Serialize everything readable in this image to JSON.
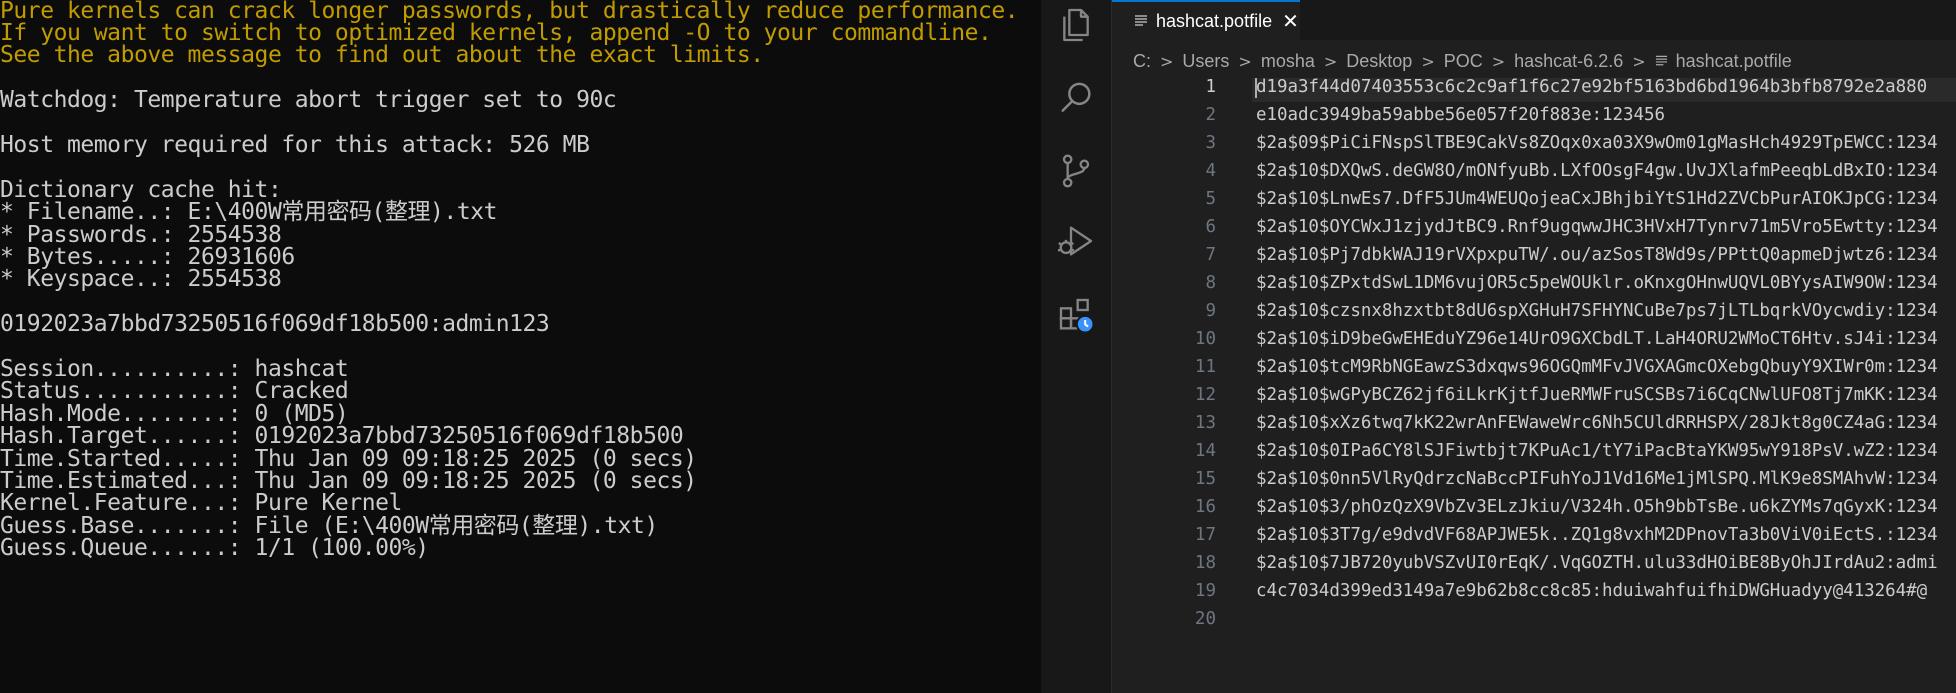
{
  "terminal": {
    "lines": [
      {
        "text": "Pure kernels can crack longer passwords, but drastically reduce performance.",
        "tone": "warn"
      },
      {
        "text": "If you want to switch to optimized kernels, append -O to your commandline.",
        "tone": "warn"
      },
      {
        "text": "See the above message to find out about the exact limits.",
        "tone": "warn"
      },
      {
        "text": "",
        "tone": "normal"
      },
      {
        "text": "Watchdog: Temperature abort trigger set to 90c",
        "tone": "normal"
      },
      {
        "text": "",
        "tone": "normal"
      },
      {
        "text": "Host memory required for this attack: 526 MB",
        "tone": "normal"
      },
      {
        "text": "",
        "tone": "normal"
      },
      {
        "text": "Dictionary cache hit:",
        "tone": "normal"
      },
      {
        "text": "* Filename..: E:\\400W常用密码(整理).txt",
        "tone": "normal"
      },
      {
        "text": "* Passwords.: 2554538",
        "tone": "normal"
      },
      {
        "text": "* Bytes.....: 26931606",
        "tone": "normal"
      },
      {
        "text": "* Keyspace..: 2554538",
        "tone": "normal"
      },
      {
        "text": "",
        "tone": "normal"
      },
      {
        "text": "0192023a7bbd73250516f069df18b500:admin123",
        "tone": "normal"
      },
      {
        "text": "",
        "tone": "normal"
      },
      {
        "text": "Session..........: hashcat",
        "tone": "normal"
      },
      {
        "text": "Status...........: Cracked",
        "tone": "normal"
      },
      {
        "text": "Hash.Mode........: 0 (MD5)",
        "tone": "normal"
      },
      {
        "text": "Hash.Target......: 0192023a7bbd73250516f069df18b500",
        "tone": "normal"
      },
      {
        "text": "Time.Started.....: Thu Jan 09 09:18:25 2025 (0 secs)",
        "tone": "normal"
      },
      {
        "text": "Time.Estimated...: Thu Jan 09 09:18:25 2025 (0 secs)",
        "tone": "normal"
      },
      {
        "text": "Kernel.Feature...: Pure Kernel",
        "tone": "normal"
      },
      {
        "text": "Guess.Base.......: File (E:\\400W常用密码(整理).txt)",
        "tone": "normal"
      },
      {
        "text": "Guess.Queue......: 1/1 (100.00%)",
        "tone": "normal"
      }
    ]
  },
  "vscode": {
    "activity_bar": [
      {
        "icon": "files-icon"
      },
      {
        "icon": "search-icon"
      },
      {
        "icon": "source-control-icon"
      },
      {
        "icon": "run-debug-icon"
      },
      {
        "icon": "extensions-icon"
      }
    ],
    "tab": {
      "label": "hashcat.potfile",
      "close_glyph": "✕"
    },
    "breadcrumb": {
      "separator": ">",
      "items": [
        "C:",
        "Users",
        "mosha",
        "Desktop",
        "POC",
        "hashcat-6.2.6",
        "hashcat.potfile"
      ]
    },
    "editor": {
      "active_line": 1,
      "lines": [
        {
          "no": "1",
          "text": "d19a3f44d07403553c6c2c9af1f6c27e92bf5163bd6bd1964b3bfb8792e2a880"
        },
        {
          "no": "2",
          "text": "e10adc3949ba59abbe56e057f20f883e:123456"
        },
        {
          "no": "3",
          "text": "$2a$09$PiCiFNspSlTBE9CakVs8ZOqx0xa03X9wOm01gMasHch4929TpEWCC:1234"
        },
        {
          "no": "4",
          "text": "$2a$10$DXQwS.deGW8O/mONfyuBb.LXfOOsgF4gw.UvJXlafmPeeqbLdBxIO:1234"
        },
        {
          "no": "5",
          "text": "$2a$10$LnwEs7.DfF5JUm4WEUQojeaCxJBhjbiYtS1Hd2ZVCbPurAIOKJpCG:1234"
        },
        {
          "no": "6",
          "text": "$2a$10$OYCWxJ1zjydJtBC9.Rnf9ugqwwJHC3HVxH7Tynrv71m5Vro5Ewtty:1234"
        },
        {
          "no": "7",
          "text": "$2a$10$Pj7dbkWAJ19rVXpxpuTW/.ou/azSosT8Wd9s/PPttQ0apmeDjwtz6:1234"
        },
        {
          "no": "8",
          "text": "$2a$10$ZPxtdSwL1DM6vujOR5c5peWOUklr.oKnxgOHnwUQVL0BYysAIW9OW:1234"
        },
        {
          "no": "9",
          "text": "$2a$10$czsnx8hzxtbt8dU6spXGHuH7SFHYNCuBe7ps7jLTLbqrkVOycwdiy:1234"
        },
        {
          "no": "10",
          "text": "$2a$10$iD9beGwEHEduYZ96e14UrO9GXCbdLT.LaH4ORU2WMoCT6Htv.sJ4i:1234"
        },
        {
          "no": "11",
          "text": "$2a$10$tcM9RbNGEawzS3dxqws96OGQmMFvJVGXAGmcOXebgQbuyY9XIWr0m:1234"
        },
        {
          "no": "12",
          "text": "$2a$10$wGPyBCZ62jf6iLkrKjtfJueRMWFruSCSBs7i6CqCNwlUFO8Tj7mKK:1234"
        },
        {
          "no": "13",
          "text": "$2a$10$xXz6twq7kK22wrAnFEWaweWrc6Nh5CUldRRHSPX/28Jkt8g0CZ4aG:1234"
        },
        {
          "no": "14",
          "text": "$2a$10$0IPa6CY8lSJFiwtbjt7KPuAc1/tY7iPacBtaYKW95wY918PsV.wZ2:1234"
        },
        {
          "no": "15",
          "text": "$2a$10$0nn5VlRyQdrzcNaBccPIFuhYoJ1Vd16Me1jMlSPQ.MlK9e8SMAhvW:1234"
        },
        {
          "no": "16",
          "text": "$2a$10$3/phOzQzX9VbZv3ELzJkiu/V324h.O5h9bbTsBe.u6kZYMs7qGyxK:1234"
        },
        {
          "no": "17",
          "text": "$2a$10$3T7g/e9dvdVF68APJWE5k..ZQ1g8vxhM2DPnovTa3b0ViV0iEctS.:1234"
        },
        {
          "no": "18",
          "text": "$2a$10$7JB720yubVSZvUI0rEqK/.VqGOZTH.ulu33dHOiBE8ByOhJIrdAu2:admi"
        },
        {
          "no": "19",
          "text": "c4c7034d399ed3149a7e9b62b8cc8c85:hduiwahfuifhiDWGHuadyy@413264#@"
        },
        {
          "no": "20",
          "text": ""
        }
      ]
    }
  },
  "colors": {
    "terminal_bg": "#0c0c0c",
    "terminal_text": "#cccccc",
    "terminal_warning": "#c19c00",
    "editor_bg": "#1f1f1f",
    "activity_bar_bg": "#181818",
    "tab_accent": "#0078d4",
    "line_number": "#6e7681"
  }
}
